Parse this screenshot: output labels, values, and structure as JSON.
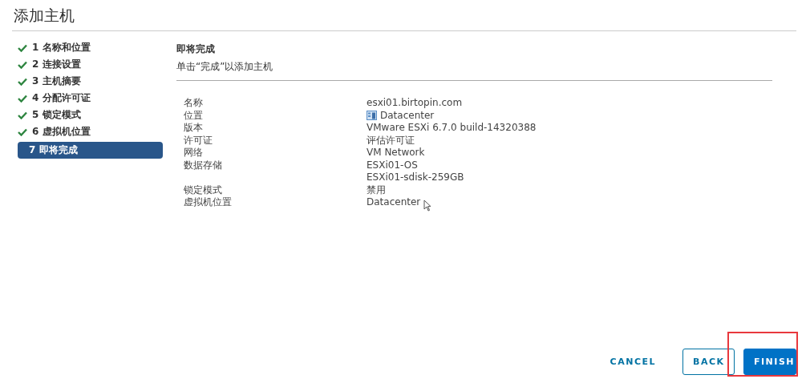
{
  "title": "添加主机",
  "steps": [
    {
      "label": "1 名称和位置",
      "done": true,
      "selected": false
    },
    {
      "label": "2 连接设置",
      "done": true,
      "selected": false
    },
    {
      "label": "3 主机摘要",
      "done": true,
      "selected": false
    },
    {
      "label": "4 分配许可证",
      "done": true,
      "selected": false
    },
    {
      "label": "5 锁定模式",
      "done": true,
      "selected": false
    },
    {
      "label": "6 虚拟机位置",
      "done": true,
      "selected": false
    },
    {
      "label": "7 即将完成",
      "done": false,
      "selected": true
    }
  ],
  "page": {
    "heading": "即将完成",
    "subtitle": "单击“完成”以添加主机"
  },
  "summary": [
    {
      "label": "名称",
      "values": [
        {
          "text": "esxi01.birtopin.com",
          "kind": "plain"
        }
      ]
    },
    {
      "label": "位置",
      "values": [
        {
          "text": "Datacenter",
          "kind": "datacenter"
        }
      ]
    },
    {
      "label": "版本",
      "values": [
        {
          "text": "VMware ESXi 6.7.0 build-14320388",
          "kind": "plain"
        }
      ]
    },
    {
      "label": "许可证",
      "values": [
        {
          "text": "评估许可证",
          "kind": "plain"
        }
      ]
    },
    {
      "label": "网络",
      "values": [
        {
          "text": "VM Network",
          "kind": "plain"
        }
      ]
    },
    {
      "label": "数据存储",
      "values": [
        {
          "text": "ESXi01-OS",
          "kind": "plain"
        },
        {
          "text": "ESXi01-sdisk-259GB",
          "kind": "plain"
        }
      ]
    },
    {
      "label": "锁定模式",
      "values": [
        {
          "text": "禁用",
          "kind": "plain"
        }
      ]
    },
    {
      "label": "虚拟机位置",
      "values": [
        {
          "text": "Datacenter",
          "kind": "plain"
        }
      ]
    }
  ],
  "buttons": [
    {
      "label": "CANCEL",
      "kind": "link"
    },
    {
      "label": "BACK",
      "kind": "outline"
    },
    {
      "label": "FINISH",
      "kind": "primary",
      "highlighted": true
    }
  ]
}
